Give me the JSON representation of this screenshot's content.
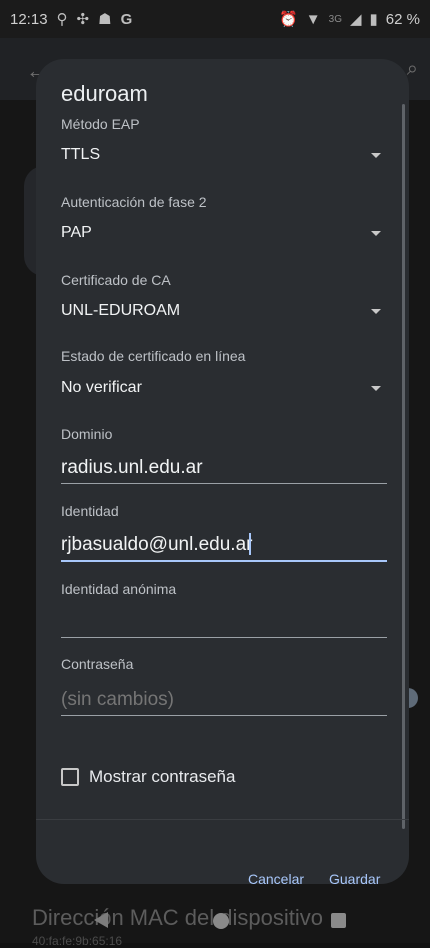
{
  "status_bar": {
    "time": "12:13",
    "left_icons": [
      "location-icon",
      "app-icon",
      "school-icon",
      "google-icon"
    ],
    "right_icons": [
      "alarm-icon",
      "wifi-icon",
      "signal-icon",
      "battery-icon"
    ],
    "network_label": "3G",
    "battery_text": "62 %"
  },
  "background": {
    "mac_title": "Dirección MAC del dispositivo",
    "mac_value": "40:fa:fe:9b:65:16"
  },
  "dialog": {
    "title": "eduroam",
    "fields": {
      "eap_method": {
        "label": "Método EAP",
        "value": "TTLS"
      },
      "phase2_auth": {
        "label": "Autenticación de fase 2",
        "value": "PAP"
      },
      "ca_certificate": {
        "label": "Certificado de CA",
        "value": "UNL-EDUROAM"
      },
      "online_cert_status": {
        "label": "Estado de certificado en línea",
        "value": "No verificar"
      },
      "domain": {
        "label": "Dominio",
        "value": "radius.unl.edu.ar"
      },
      "identity": {
        "label": "Identidad",
        "value": "rjbasualdo@unl.edu.ar"
      },
      "anonymous_identity": {
        "label": "Identidad anónima",
        "value": ""
      },
      "password": {
        "label": "Contraseña",
        "placeholder": "(sin cambios)"
      }
    },
    "show_password_label": "Mostrar contraseña",
    "buttons": {
      "cancel": "Cancelar",
      "save": "Guardar"
    }
  }
}
